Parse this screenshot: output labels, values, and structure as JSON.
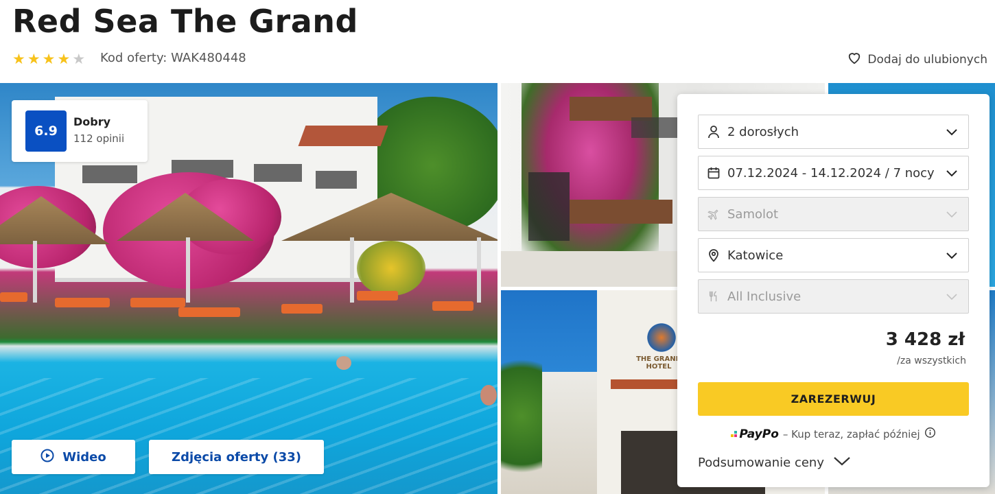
{
  "hotel": {
    "title": "Red Sea The Grand",
    "stars_filled": 4,
    "stars_total": 5,
    "offer_code": "Kod oferty: WAK480448",
    "favorite_label": "Dodaj do ulubionych"
  },
  "rating": {
    "score": "6.9",
    "word": "Dobry",
    "count": "112 opinii"
  },
  "gallery": {
    "video_label": "Wideo",
    "photos_label": "Zdjęcia oferty (33)",
    "sign_text": "THE GRAND HOTEL"
  },
  "booking": {
    "persons": "2 dorosłych",
    "dates": "07.12.2024 - 14.12.2024 / 7 nocy",
    "transport": "Samolot",
    "departure": "Katowice",
    "board": "All Inclusive",
    "price": "3 428 zł",
    "price_note": "/za wszystkich",
    "reserve_label": "ZAREZERWUJ",
    "paypo_brand": "PayPo",
    "paypo_text": "– Kup teraz, zapłać później",
    "summary_label": "Podsumowanie ceny"
  },
  "icons": {
    "star": "star-icon",
    "heart": "heart-icon",
    "play": "play-icon",
    "person": "person-icon",
    "calendar": "calendar-icon",
    "plane": "plane-icon",
    "pin": "location-pin-icon",
    "cutlery": "cutlery-icon",
    "chevron": "chevron-down-icon",
    "info": "info-icon"
  },
  "colors": {
    "star_filled": "#f7c21b",
    "star_empty": "#c8c8c8",
    "rating_badge": "#0a50c2",
    "link_blue": "#0b4aa8",
    "reserve_yellow": "#f9ca24"
  }
}
